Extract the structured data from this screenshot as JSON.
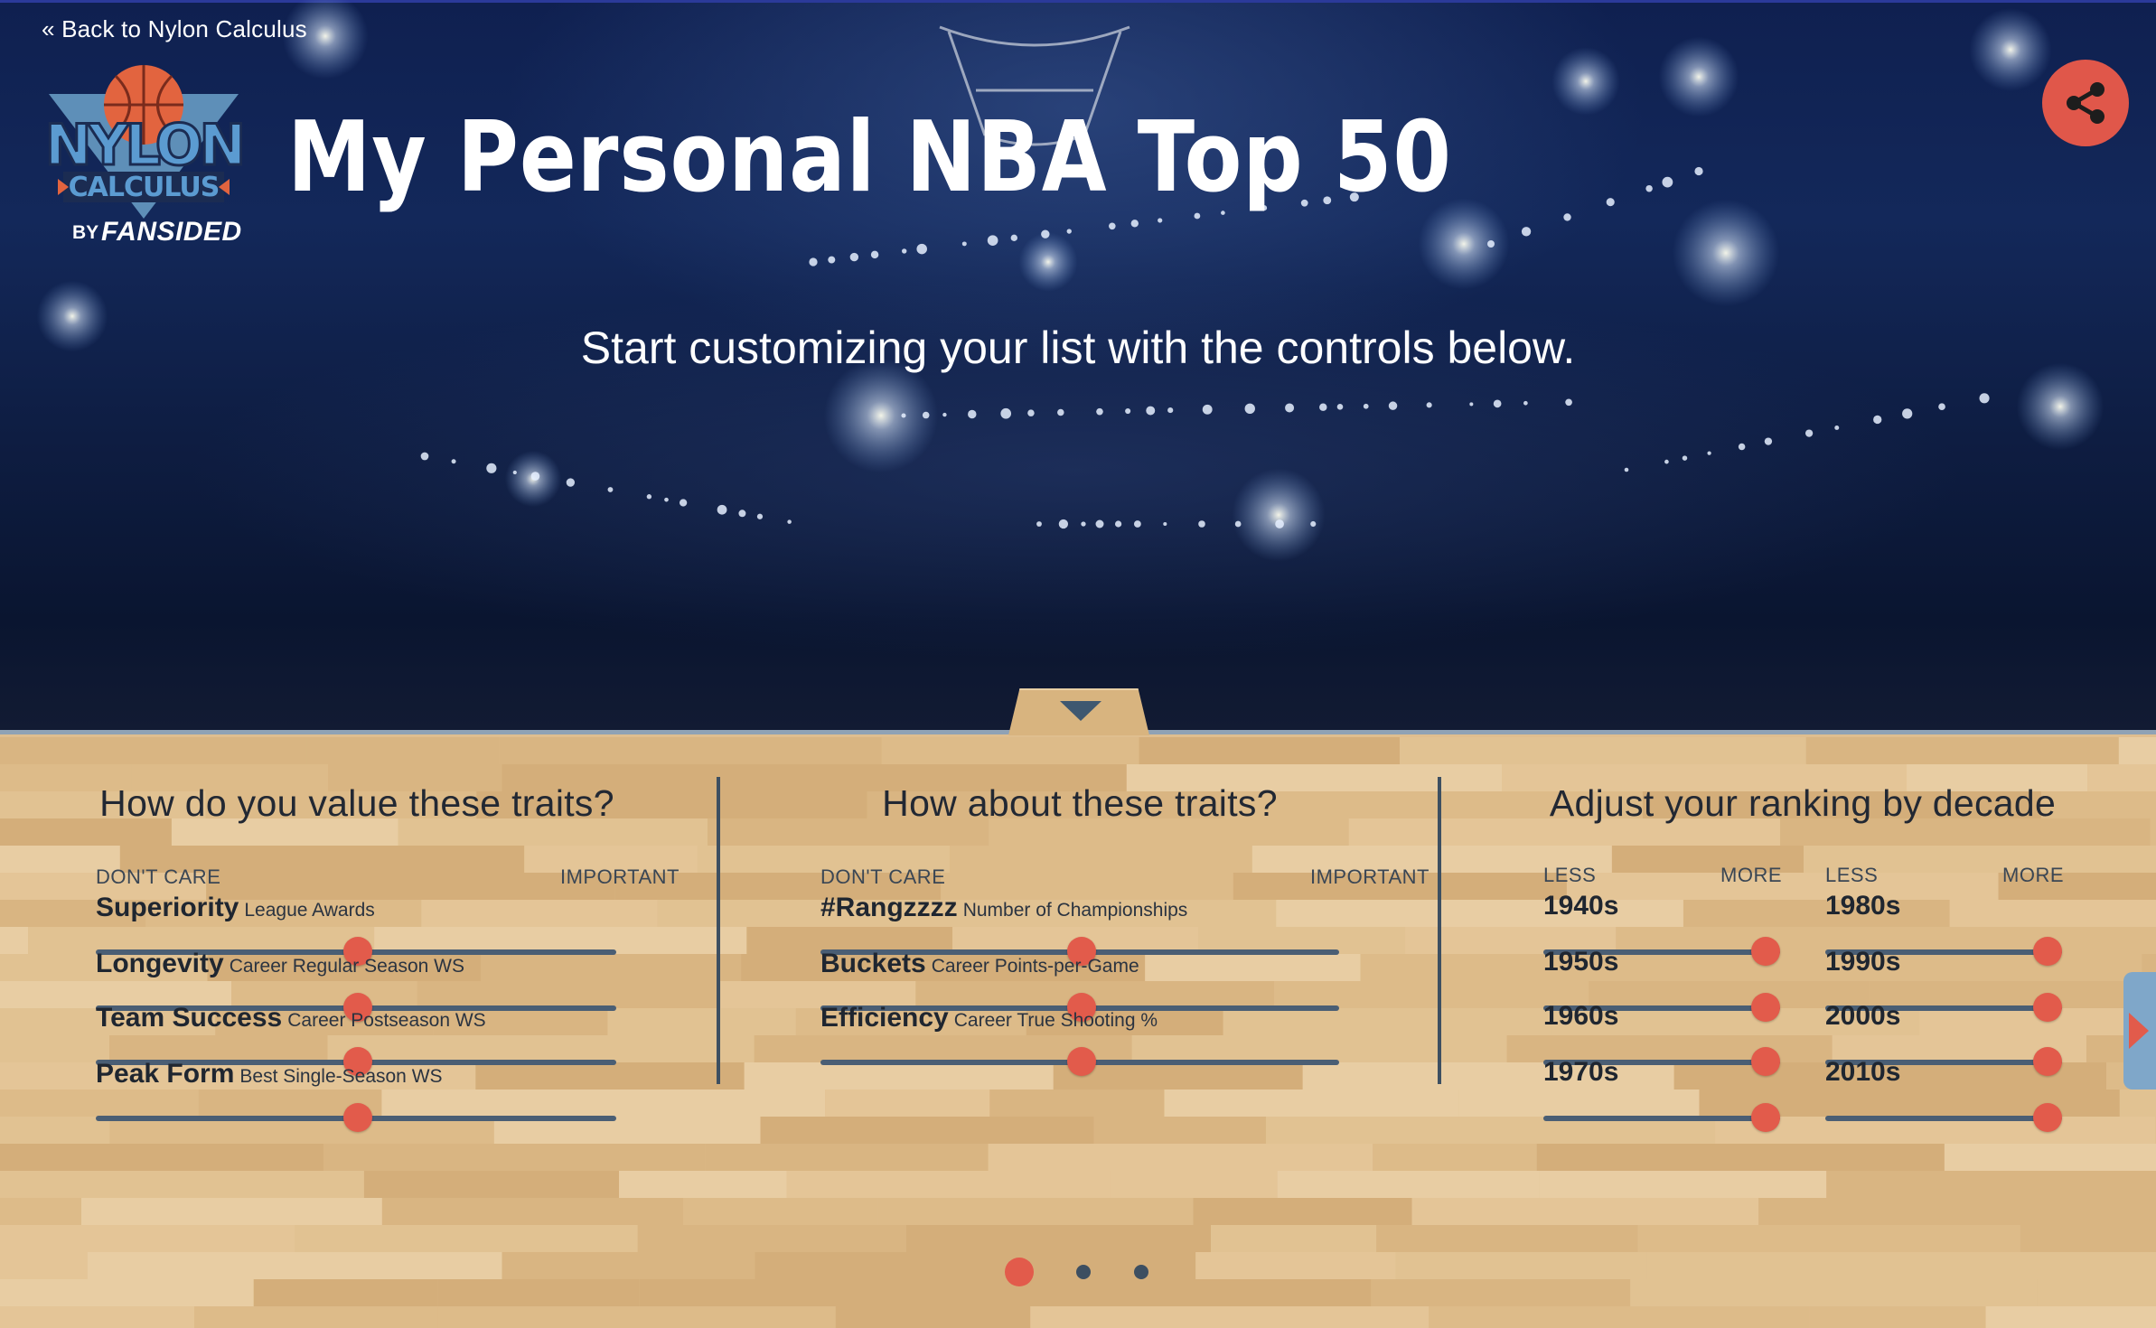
{
  "header": {
    "back_link": "« Back to Nylon Calculus",
    "logo_line1": "NYLON",
    "logo_line2": "CALCULUS",
    "logo_by": "BY",
    "logo_brand": "FANSIDED",
    "title": "My Personal NBA Top 50",
    "subtitle": "Start customizing your list with the controls below.",
    "share_icon": "share-icon"
  },
  "colors": {
    "accent": "#e25b4b",
    "track": "#4a5e74",
    "divider": "#3d4f61",
    "hero_bg": "#0f2050",
    "court": "#dfbe8f"
  },
  "panel1": {
    "heading": "How do you value these traits?",
    "low_label": "DON'T CARE",
    "high_label": "IMPORTANT",
    "traits": [
      {
        "name": "Superiority",
        "desc": "League Awards",
        "value": 0.5
      },
      {
        "name": "Longevity",
        "desc": "Career Regular Season WS",
        "value": 0.5
      },
      {
        "name": "Team Success",
        "desc": "Career Postseason WS",
        "value": 0.5
      },
      {
        "name": "Peak Form",
        "desc": "Best Single-Season WS",
        "value": 0.5
      }
    ]
  },
  "panel2": {
    "heading": "How about these traits?",
    "low_label": "DON'T CARE",
    "high_label": "IMPORTANT",
    "traits": [
      {
        "name": "#Rangzzzz",
        "desc": "Number of Championships",
        "value": 0.5
      },
      {
        "name": "Buckets",
        "desc": "Career Points-per-Game",
        "value": 0.5
      },
      {
        "name": "Efficiency",
        "desc": "Career True Shooting %",
        "value": 0.5
      }
    ]
  },
  "panel3": {
    "heading": "Adjust your ranking by decade",
    "low_label": "LESS",
    "high_label": "MORE",
    "decades": [
      {
        "label": "1940s",
        "value": 1.0
      },
      {
        "label": "1950s",
        "value": 1.0
      },
      {
        "label": "1960s",
        "value": 1.0
      },
      {
        "label": "1970s",
        "value": 1.0
      },
      {
        "label": "1980s",
        "value": 1.0
      },
      {
        "label": "1990s",
        "value": 1.0
      },
      {
        "label": "2000s",
        "value": 1.0
      },
      {
        "label": "2010s",
        "value": 1.0
      }
    ]
  },
  "pagination": {
    "total": 3,
    "active": 1
  }
}
